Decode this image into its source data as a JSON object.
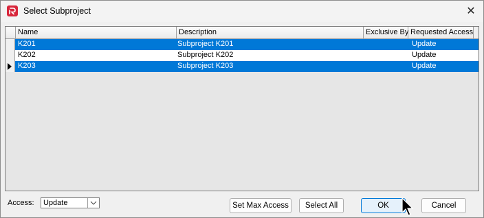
{
  "window": {
    "title": "Select Subproject",
    "close_glyph": "✕",
    "app_icon": "app-logo-icon"
  },
  "grid": {
    "columns": [
      "Name",
      "Description",
      "Exclusive By",
      "Requested Access"
    ],
    "rows": [
      {
        "name": "K201",
        "description": "Subproject K201",
        "exclusive_by": "",
        "requested_access": "Update",
        "selected": true
      },
      {
        "name": "K202",
        "description": "Subproject K202",
        "exclusive_by": "",
        "requested_access": "Update",
        "selected": false
      },
      {
        "name": "K203",
        "description": "Subproject K203",
        "exclusive_by": "",
        "requested_access": "Update",
        "selected": true,
        "current": true
      }
    ]
  },
  "footer": {
    "access_label": "Access:",
    "access_value": "Update",
    "set_max_access_label": "Set Max Access",
    "select_all_label": "Select All",
    "ok_label": "OK",
    "cancel_label": "Cancel"
  },
  "colors": {
    "selection": "#0078d7",
    "default_button_border": "#0078d7",
    "app_icon": "#d8263b"
  }
}
